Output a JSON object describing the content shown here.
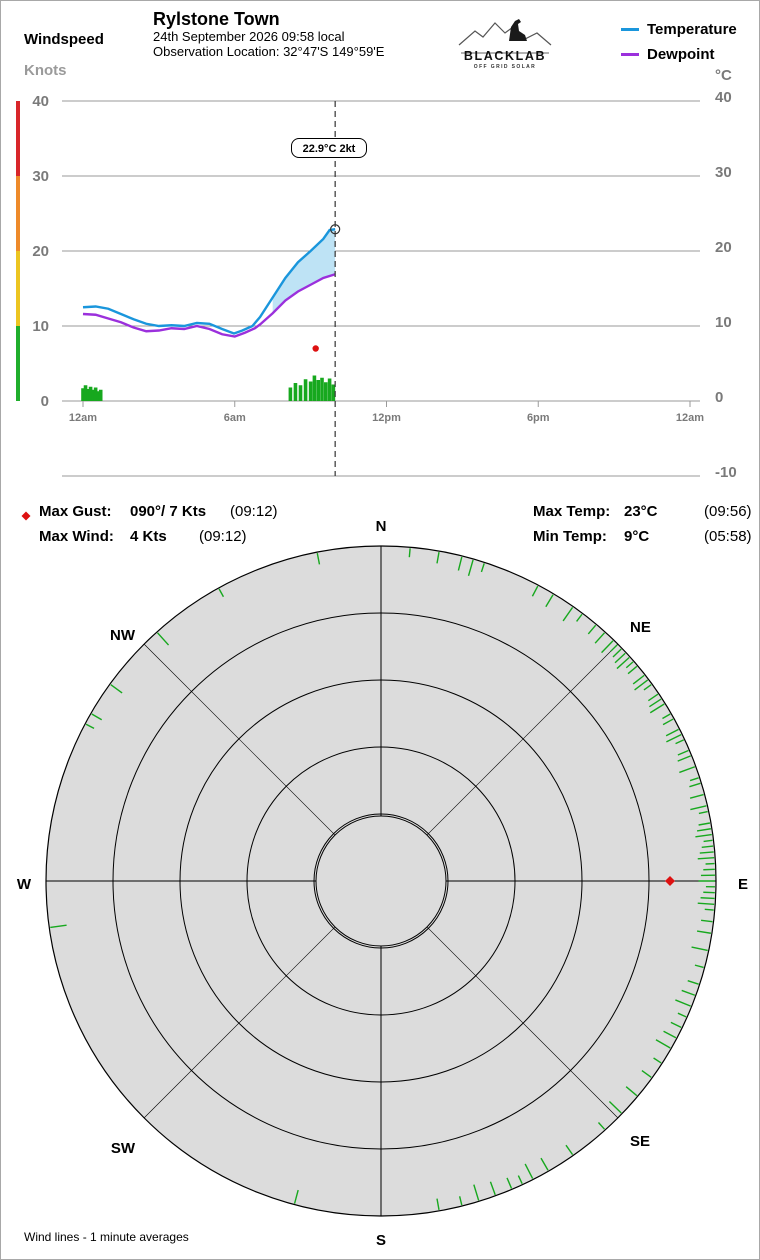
{
  "header": {
    "left_axis_title": "Windspeed",
    "left_axis_unit": "Knots",
    "station": "Rylstone Town",
    "date_line": "24th September 2026  09:58 local",
    "observation_line": "Observation Location:  32°47'S 149°59'E",
    "right_axis_unit": "°C",
    "logo_text": "BLACKLAB",
    "logo_sub": "OFF GRID SOLAR"
  },
  "legend": [
    {
      "label": "Temperature",
      "color": "#1a96dc"
    },
    {
      "label": "Dewpoint",
      "color": "#9b30dc"
    }
  ],
  "colors": {
    "temperature": "#1a96dc",
    "dewpoint": "#9b30dc",
    "fill_between": "#bee3f5",
    "wind": "#17a81e",
    "gust": "#dd1111",
    "scale_red": "#d8262a",
    "scale_orange": "#ee8a2a",
    "scale_yellow": "#ecc521",
    "scale_green": "#1fae2c",
    "rose_bg": "#dcdcdc"
  },
  "tooltip": {
    "text": "22.9°C  2kt"
  },
  "stats": {
    "max_gust_label": "Max Gust:",
    "max_gust_value": "090°/  7 Kts",
    "max_gust_time": "(09:12)",
    "max_wind_label": "Max Wind:",
    "max_wind_value": "4 Kts",
    "max_wind_time": "(09:12)",
    "max_temp_label": "Max Temp:",
    "max_temp_value": "23°C",
    "max_temp_time": "(09:56)",
    "min_temp_label": "Min Temp:",
    "min_temp_value": "9°C",
    "min_temp_time": "(05:58)"
  },
  "compass": [
    "N",
    "NE",
    "E",
    "SE",
    "S",
    "SW",
    "W",
    "NW"
  ],
  "footer": "Wind lines - 1 minute averages",
  "chart_data": [
    {
      "type": "line",
      "x_unit": "hour of day",
      "x_ticks": [
        {
          "value": 0,
          "label": "12am"
        },
        {
          "value": 6,
          "label": "6am"
        },
        {
          "value": 12,
          "label": "12pm"
        },
        {
          "value": 18,
          "label": "6pm"
        },
        {
          "value": 24,
          "label": "12am"
        }
      ],
      "x_range": [
        0,
        24
      ],
      "left_axis": {
        "label": "Knots",
        "range": [
          0,
          40
        ],
        "ticks": [
          0,
          10,
          20,
          30,
          40
        ]
      },
      "right_axis": {
        "label": "°C",
        "range": [
          -10,
          40
        ],
        "ticks": [
          -10,
          0,
          10,
          20,
          30,
          40
        ]
      },
      "grid": true,
      "cursor_hour": 9.97,
      "series": [
        {
          "name": "Temperature",
          "axis": "right",
          "points": [
            [
              0,
              12.5
            ],
            [
              0.5,
              12.6
            ],
            [
              1,
              12.3
            ],
            [
              1.5,
              11.6
            ],
            [
              2,
              10.9
            ],
            [
              2.5,
              10.3
            ],
            [
              3,
              10.0
            ],
            [
              3.5,
              10.1
            ],
            [
              4,
              10.0
            ],
            [
              4.5,
              10.4
            ],
            [
              5,
              10.3
            ],
            [
              5.5,
              9.6
            ],
            [
              5.97,
              9.0
            ],
            [
              6.3,
              9.4
            ],
            [
              6.7,
              10.0
            ],
            [
              7,
              11.2
            ],
            [
              7.5,
              13.8
            ],
            [
              8,
              16.4
            ],
            [
              8.5,
              18.5
            ],
            [
              9,
              20.0
            ],
            [
              9.5,
              21.6
            ],
            [
              9.75,
              22.8
            ],
            [
              9.97,
              22.9
            ]
          ]
        },
        {
          "name": "Dewpoint",
          "axis": "right",
          "points": [
            [
              0,
              11.6
            ],
            [
              0.5,
              11.5
            ],
            [
              1,
              11.0
            ],
            [
              1.5,
              10.5
            ],
            [
              2,
              9.8
            ],
            [
              2.5,
              9.3
            ],
            [
              3,
              9.4
            ],
            [
              3.5,
              9.7
            ],
            [
              4,
              9.6
            ],
            [
              4.5,
              10.0
            ],
            [
              5,
              9.6
            ],
            [
              5.5,
              8.9
            ],
            [
              6,
              8.6
            ],
            [
              6.4,
              9.1
            ],
            [
              6.8,
              9.7
            ],
            [
              7,
              10.2
            ],
            [
              7.5,
              11.7
            ],
            [
              8,
              13.4
            ],
            [
              8.5,
              14.6
            ],
            [
              9,
              15.5
            ],
            [
              9.5,
              16.4
            ],
            [
              9.97,
              16.9
            ]
          ]
        },
        {
          "name": "Wind",
          "axis": "left",
          "style": "bars",
          "points": [
            [
              0,
              1.7
            ],
            [
              0.1,
              2.1
            ],
            [
              0.2,
              1.6
            ],
            [
              0.3,
              1.9
            ],
            [
              0.4,
              1.5
            ],
            [
              0.5,
              1.8
            ],
            [
              0.6,
              1.3
            ],
            [
              0.7,
              1.5
            ],
            [
              8.2,
              1.8
            ],
            [
              8.4,
              2.4
            ],
            [
              8.6,
              2.1
            ],
            [
              8.8,
              2.9
            ],
            [
              9.0,
              2.6
            ],
            [
              9.15,
              3.4
            ],
            [
              9.3,
              2.8
            ],
            [
              9.45,
              3.1
            ],
            [
              9.6,
              2.5
            ],
            [
              9.75,
              3.0
            ],
            [
              9.9,
              2.2
            ]
          ]
        },
        {
          "name": "Max gust",
          "axis": "left",
          "style": "marker",
          "points": [
            [
              9.2,
              7
            ]
          ]
        }
      ]
    },
    {
      "type": "scatter",
      "chart": "wind rose",
      "rings": 5,
      "wind_direction_degrees": [
        5,
        10,
        14,
        16,
        18,
        28,
        31,
        35,
        37,
        40,
        42,
        44,
        45,
        46,
        47,
        48,
        49,
        50,
        52,
        53,
        54,
        56,
        57,
        58,
        60,
        61,
        63,
        64,
        65,
        67,
        68,
        70,
        72,
        73,
        75,
        77,
        78,
        80,
        81,
        82,
        83,
        84,
        85,
        86,
        87,
        88,
        89,
        90,
        91,
        92,
        93,
        94,
        95,
        97,
        99,
        102,
        105,
        108,
        110,
        112,
        114,
        116,
        118,
        120,
        123,
        126,
        130,
        134,
        138,
        145,
        150,
        153,
        155,
        157,
        160,
        163,
        166,
        170,
        195,
        262,
        298,
        300,
        306,
        318,
        331,
        349
      ],
      "max_gust_direction": 90
    }
  ]
}
